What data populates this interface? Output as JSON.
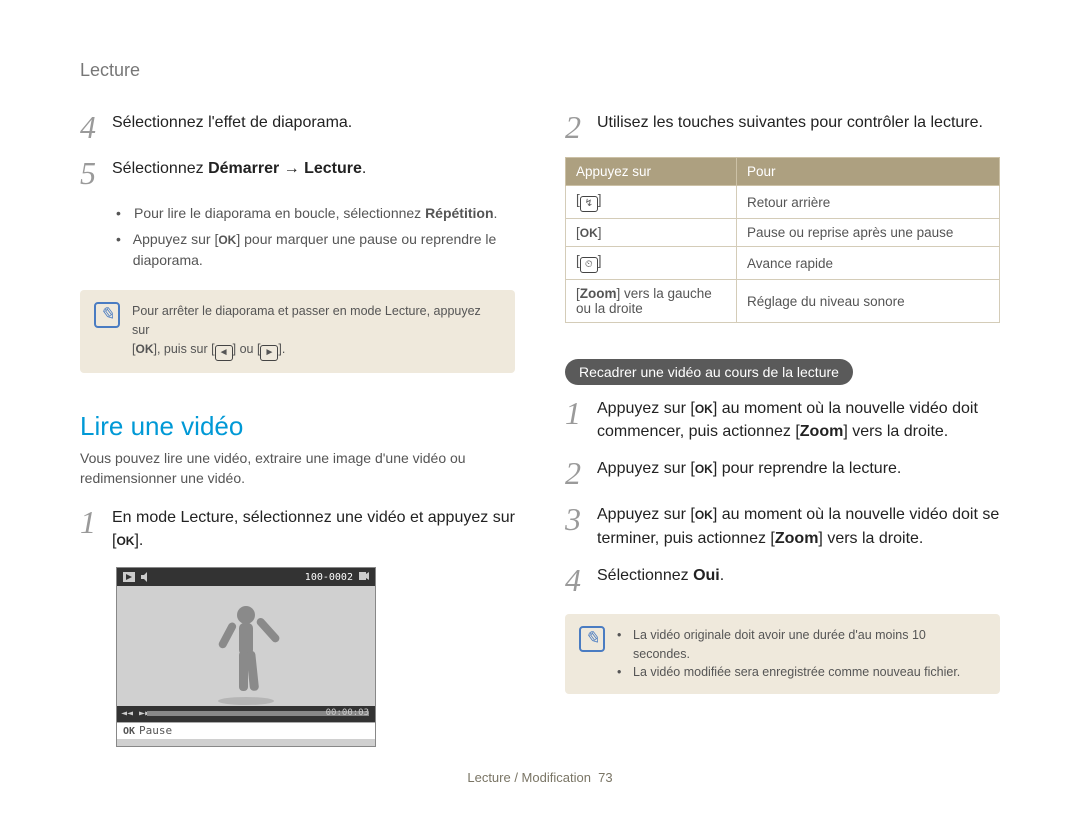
{
  "header": "Lecture",
  "left": {
    "step4": "Sélectionnez l'effet de diaporama.",
    "step5_pre": "Sélectionnez ",
    "step5_b1": "Démarrer",
    "step5_arrow": " → ",
    "step5_b2": "Lecture",
    "step5_end": ".",
    "bullet1_pre": "Pour lire le diaporama en boucle, sélectionnez ",
    "bullet1_b": "Répétition",
    "bullet1_end": ".",
    "bullet2_pre": "Appuyez sur [",
    "bullet2_ok": "OK",
    "bullet2_post": "] pour marquer une pause ou reprendre le diaporama.",
    "note1_line1_pre": "Pour arrêter le diaporama et passer en mode Lecture, appuyez sur",
    "note1_line2_pre": "[",
    "note1_line2_ok": "OK",
    "note1_line2_mid": "], puis sur [",
    "note1_line2_i1": "◄",
    "note1_line2_or": "] ou [",
    "note1_line2_i2": "►",
    "note1_line2_end": "].",
    "section_title": "Lire une vidéo",
    "intro": "Vous pouvez lire une vidéo, extraire une image d'une vidéo ou redimensionner une vidéo.",
    "vstep1_pre": "En mode Lecture, sélectionnez une vidéo et appuyez sur [",
    "vstep1_ok": "OK",
    "vstep1_end": "].",
    "mock": {
      "tag": "100-0002",
      "timer": "00:00:03",
      "bottom_ok": "OK",
      "bottom_label": "Pause"
    }
  },
  "right": {
    "step2": "Utilisez les touches suivantes pour contrôler la lecture.",
    "table": {
      "h1": "Appuyez sur",
      "h2": "Pour",
      "rows": [
        {
          "k": "[◄]",
          "v": "Retour arrière"
        },
        {
          "k": "[OK]",
          "v": "Pause ou reprise après une pause"
        },
        {
          "k": "[►]",
          "v": "Avance rapide"
        },
        {
          "k": "[Zoom] vers la gauche ou la droite",
          "v": "Réglage du niveau sonore"
        }
      ]
    },
    "pill": "Recadrer une vidéo au cours de la lecture",
    "r1_pre": "Appuyez sur [",
    "r1_ok": "OK",
    "r1_mid": "] au moment où la nouvelle vidéo doit commencer, puis actionnez [",
    "r1_zoom": "Zoom",
    "r1_end": "] vers la droite.",
    "r2_pre": "Appuyez sur [",
    "r2_ok": "OK",
    "r2_end": "] pour reprendre la lecture.",
    "r3_pre": "Appuyez sur [",
    "r3_ok": "OK",
    "r3_mid": "] au moment où la nouvelle vidéo doit se terminer, puis actionnez [",
    "r3_zoom": "Zoom",
    "r3_end": "] vers la droite.",
    "r4_pre": "Sélectionnez ",
    "r4_b": "Oui",
    "r4_end": ".",
    "note2_b1": "La vidéo originale doit avoir une durée d'au moins 10 secondes.",
    "note2_b2": "La vidéo modifiée sera enregistrée comme nouveau fichier."
  },
  "footer": {
    "text": "Lecture / Modification",
    "page": "73"
  }
}
